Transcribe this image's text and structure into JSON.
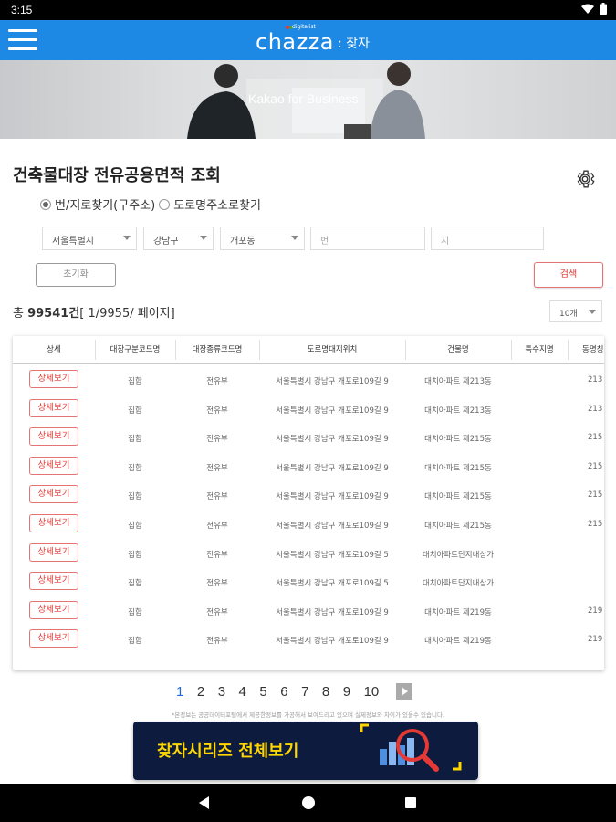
{
  "status_bar": {
    "time": "3:15"
  },
  "app_bar": {
    "logo_main": "chazza",
    "logo_sub": ": 찾자",
    "logo_small": "digitalist"
  },
  "banner": {
    "text": "Kakao for Business"
  },
  "page": {
    "title": "건축물대장 전유공용면적 조회",
    "radio_lot": "번/지로찾기(구주소)",
    "radio_road": "도로명주소로찾기",
    "radio_lot_checked": true
  },
  "filters": {
    "sido": "서울특별시",
    "sigungu": "강남구",
    "dong": "개포동",
    "bun_placeholder": "번",
    "ji_placeholder": "지",
    "reset_label": "초기화",
    "search_label": "검색"
  },
  "results": {
    "prefix": "총 ",
    "count": "99541건",
    "pages": "[ 1/9955/ 페이지]",
    "page_size": "10개"
  },
  "table": {
    "headers": [
      "상세",
      "대장구분코드명",
      "대장종류코드명",
      "도로명대지위치",
      "건물명",
      "특수지명",
      "동명칭"
    ],
    "detail_label": "상세보기",
    "rows": [
      [
        "집합",
        "전유부",
        "서울특별시 강남구 개포로109길 9",
        "대치아파트 제213동",
        "",
        "213"
      ],
      [
        "집합",
        "전유부",
        "서울특별시 강남구 개포로109길 9",
        "대치아파트 제213동",
        "",
        "213"
      ],
      [
        "집합",
        "전유부",
        "서울특별시 강남구 개포로109길 9",
        "대치아파트 제215동",
        "",
        "215"
      ],
      [
        "집합",
        "전유부",
        "서울특별시 강남구 개포로109길 9",
        "대치아파트 제215동",
        "",
        "215"
      ],
      [
        "집합",
        "전유부",
        "서울특별시 강남구 개포로109길 9",
        "대치아파트 제215동",
        "",
        "215"
      ],
      [
        "집합",
        "전유부",
        "서울특별시 강남구 개포로109길 9",
        "대치아파트 제215동",
        "",
        "215"
      ],
      [
        "집합",
        "전유부",
        "서울특별시 강남구 개포로109길 5",
        "대치아파트단지내상가",
        "",
        ""
      ],
      [
        "집합",
        "전유부",
        "서울특별시 강남구 개포로109길 5",
        "대치아파트단지내상가",
        "",
        ""
      ],
      [
        "집합",
        "전유부",
        "서울특별시 강남구 개포로109길 9",
        "대치아파트 제219동",
        "",
        "219"
      ],
      [
        "집합",
        "전유부",
        "서울특별시 강남구 개포로109길 9",
        "대치아파트 제219동",
        "",
        "219"
      ]
    ]
  },
  "pagination": {
    "pages": [
      "1",
      "2",
      "3",
      "4",
      "5",
      "6",
      "7",
      "8",
      "9",
      "10"
    ],
    "active": "1"
  },
  "notice": "*본정보는 공공데이터포털에서 제공한정보를 가공해서 보여드리고 있으며 실제정보와 차이가 있을수 있습니다.",
  "ad": {
    "text": "찾자시리즈 전체보기"
  },
  "colors": {
    "app_bar": "#1e88e5",
    "accent_red": "#e53935",
    "active_page": "#1e6bd6",
    "ad_bg": "#0d1b3e",
    "ad_text": "#ffd600"
  }
}
